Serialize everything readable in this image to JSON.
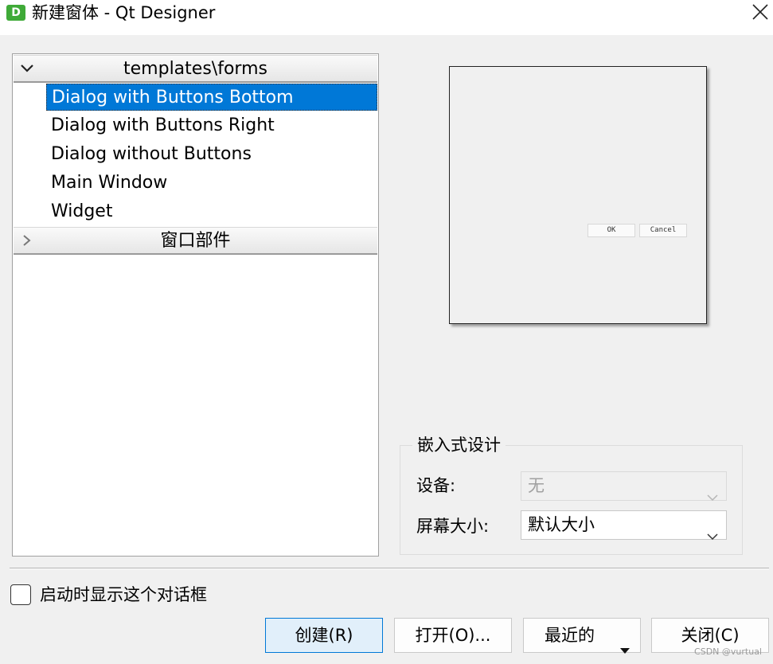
{
  "window": {
    "icon_letter": "D",
    "title": "新建窗体 - Qt Designer"
  },
  "tree": {
    "groups": [
      {
        "label": "templates\\forms",
        "expanded": true
      },
      {
        "label": "窗口部件",
        "expanded": false
      }
    ],
    "items": [
      {
        "label": "Dialog with Buttons Bottom",
        "selected": true
      },
      {
        "label": "Dialog with Buttons Right",
        "selected": false
      },
      {
        "label": "Dialog without Buttons",
        "selected": false
      },
      {
        "label": "Main Window",
        "selected": false
      },
      {
        "label": "Widget",
        "selected": false
      }
    ]
  },
  "preview": {
    "ok_label": "OK",
    "cancel_label": "Cancel"
  },
  "embedded": {
    "title": "嵌入式设计",
    "device_label": "设备:",
    "device_value": "无",
    "screen_size_label": "屏幕大小:",
    "screen_size_value": "默认大小"
  },
  "footer": {
    "show_on_startup_label": "启动时显示这个对话框",
    "show_on_startup_checked": false,
    "create_label": "创建(R)",
    "open_label": "打开(O)...",
    "recent_label": "最近的",
    "close_label": "关闭(C)",
    "watermark": "CSDN @vurtual"
  },
  "colors": {
    "selection": "#0078d7",
    "default_button": "#e1effa",
    "app_icon": "#3faa38"
  }
}
